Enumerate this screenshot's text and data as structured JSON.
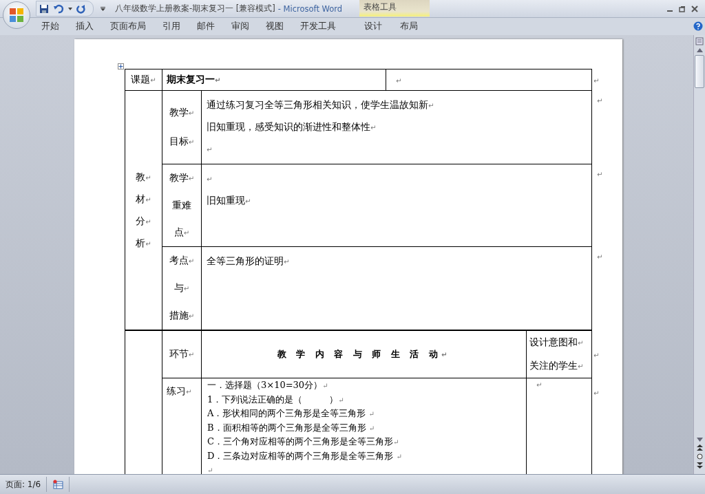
{
  "title_bar": {
    "title": "八年级数学上册教案-期末复习一 [兼容模式]",
    "app_name": "- Microsoft Word",
    "context_group": "表格工具"
  },
  "ribbon_tabs": [
    {
      "label": "开始",
      "kind": "standard"
    },
    {
      "label": "插入",
      "kind": "standard"
    },
    {
      "label": "页面布局",
      "kind": "standard"
    },
    {
      "label": "引用",
      "kind": "standard"
    },
    {
      "label": "邮件",
      "kind": "standard"
    },
    {
      "label": "审阅",
      "kind": "standard"
    },
    {
      "label": "视图",
      "kind": "standard"
    },
    {
      "label": "开发工具",
      "kind": "standard"
    },
    {
      "label": "设计",
      "kind": "contextual"
    },
    {
      "label": "布局",
      "kind": "contextual"
    }
  ],
  "lesson_table": {
    "topic_row": {
      "label": {
        "text": "课题",
        "mark": "↵"
      },
      "topic": {
        "text": "期末复习一",
        "mark": "↵"
      },
      "extra": {
        "mark": "↵"
      },
      "end_mark": "↵"
    },
    "analysis_label": [
      {
        "text": "教",
        "mark": "↵"
      },
      {
        "text": "材",
        "mark": "↵"
      },
      {
        "text": "分",
        "mark": "↵"
      },
      {
        "text": "析",
        "mark": "↵"
      }
    ],
    "analysis_rows": [
      {
        "label": [
          {
            "text": "教学",
            "mark": "↵"
          },
          {
            "text": "目标",
            "mark": "↵"
          }
        ],
        "content": [
          {
            "text": "通过练习复习全等三角形相关知识，使学生温故知新",
            "mark": "↵"
          },
          {
            "text": "旧知重现，感受知识的渐进性和整体性",
            "mark": "↵"
          },
          {
            "mark": "↵"
          }
        ],
        "end_mark": "↵"
      },
      {
        "label": [
          {
            "text": "教学",
            "mark": "↵"
          },
          {
            "text": "重难"
          },
          {
            "text": "点",
            "mark": "↵"
          }
        ],
        "content": [
          {
            "mark": "↵"
          },
          {
            "text": "旧知重现",
            "mark": "↵"
          }
        ],
        "end_mark": "↵"
      },
      {
        "label": [
          {
            "text": "考点",
            "mark": "↵"
          },
          {
            "text": "与",
            "mark": "↵"
          },
          {
            "text": "措施",
            "mark": "↵"
          }
        ],
        "content": [
          {
            "text": "全等三角形的证明",
            "mark": "↵"
          }
        ],
        "end_mark": "↵"
      }
    ],
    "activity_header": {
      "stage": {
        "text": "环节",
        "mark": "↵"
      },
      "content": {
        "text": "教 学 内 容 与 师 生 活 动",
        "mark": "↵"
      },
      "intent": [
        {
          "text": "设计意图和",
          "mark": "↵"
        },
        {
          "text": "关注的学生",
          "mark": "↵"
        }
      ],
      "end_mark": "↵"
    },
    "activity_rows": [
      {
        "stage": {
          "text": "练习",
          "mark": "↵"
        },
        "content": [
          {
            "text": "一．选择题（3×10=30分）",
            "mark": "↵"
          },
          {
            "text": "1．下列说法正确的是（　　　）",
            "mark": "↵"
          },
          {
            "text": "A．形状相同的两个三角形是全等三角形 ",
            "mark": "↵"
          },
          {
            "text": "B．面积相等的两个三角形是全等三角形 ",
            "mark": "↵"
          },
          {
            "text": "C．三个角对应相等的两个三角形是全等三角形",
            "mark": "↵"
          },
          {
            "text": "D．三条边对应相等的两个三角形是全等三角形 ",
            "mark": "↵"
          },
          {
            "mark": "↵"
          }
        ],
        "intent": [
          {
            "mark": "↵"
          }
        ],
        "end_mark": "↵"
      }
    ]
  },
  "status_bar": {
    "page": "页面: 1/6"
  }
}
